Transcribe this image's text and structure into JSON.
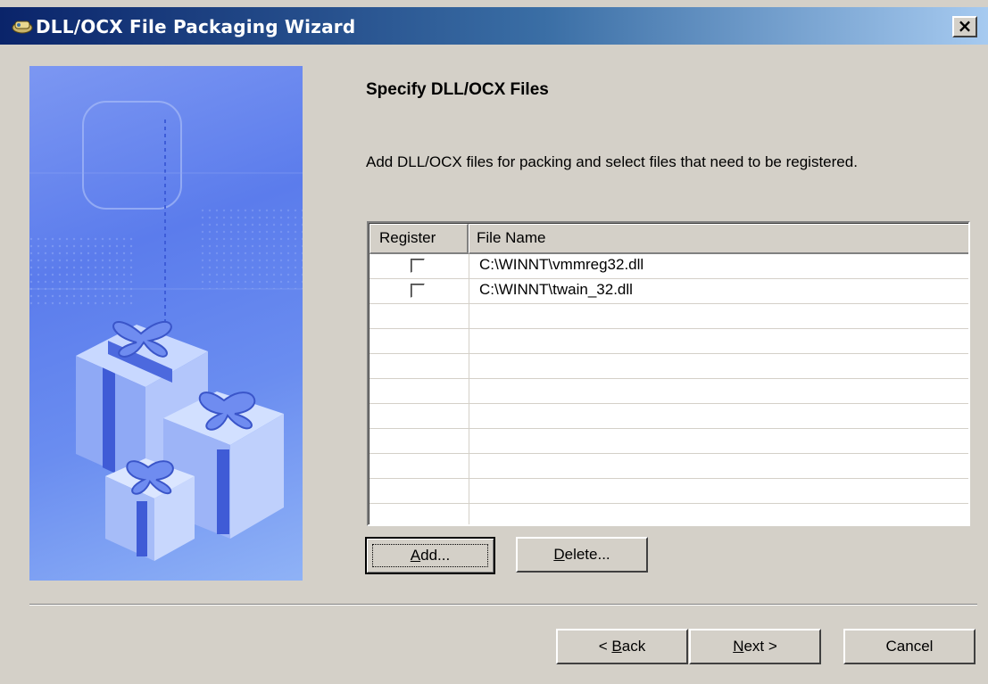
{
  "window": {
    "title": "DLL/OCX File Packaging Wizard",
    "close_label": "×"
  },
  "page": {
    "heading": "Specify DLL/OCX Files",
    "description": "Add DLL/OCX files for packing and select files that need to be registered."
  },
  "file_list": {
    "columns": [
      "Register",
      "File Name"
    ],
    "rows": [
      {
        "register": false,
        "file_name": "C:\\WINNT\\vmmreg32.dll"
      },
      {
        "register": false,
        "file_name": "C:\\WINNT\\twain_32.dll"
      }
    ]
  },
  "buttons": {
    "add": {
      "pre": "",
      "mnemonic": "A",
      "post": "dd..."
    },
    "delete": {
      "pre": "",
      "mnemonic": "D",
      "post": "elete..."
    },
    "back": {
      "pre": "< ",
      "mnemonic": "B",
      "post": "ack"
    },
    "next": {
      "pre": "",
      "mnemonic": "N",
      "post": "ext >"
    },
    "cancel": "Cancel"
  },
  "colors": {
    "titlebar_start": "#0a246a",
    "titlebar_end": "#a6caf0",
    "dialog_bg": "#d4d0c8",
    "panel_blue": "#5b7cec"
  },
  "icons": [
    "app-icon",
    "close-icon",
    "gift-boxes-illustration"
  ]
}
